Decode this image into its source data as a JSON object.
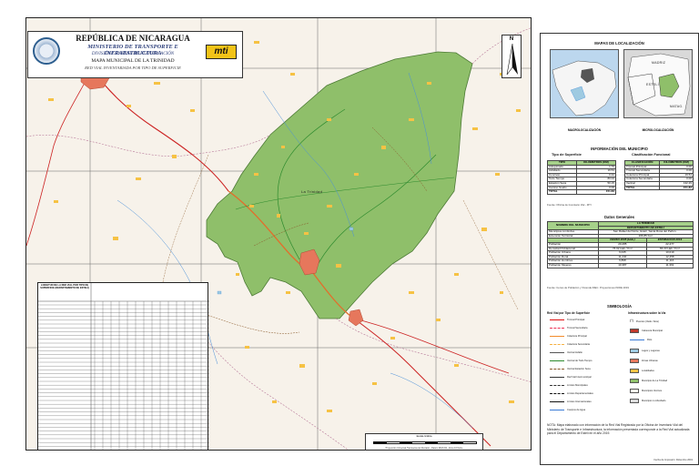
{
  "title": {
    "country": "REPÚBLICA DE NICARAGUA",
    "ministry": "MINISTERIO DE TRANSPORTE E INFRAESTRUCTURA",
    "division": "DIVISIÓN GENERAL DE PLANIFICACIÓN",
    "map_name": "MAPA MUNICIPAL DE LA TRINIDAD",
    "subtitle": "RED VIAL INVENTARIADA POR TIPO DE SUPERFICIE",
    "logo_text": "mti"
  },
  "map": {
    "north_label": "N",
    "town_label": "La Trinidad"
  },
  "scale": {
    "title": "Escala Gráfica",
    "footer": "Proyección Universal Transversa de Mercator · Datum WGS 84 · Zona 16 Norte"
  },
  "length_table": {
    "title": "LONGITUD DE LA RED VIAL POR TIPO DE SUPERFICIE (DEPARTAMENTO DE ESTELÍ)"
  },
  "panel": {
    "loc_header": "MAPAS DE LOCALIZACIÓN",
    "macro_caption": "MACROLOCALIZACIÓN",
    "micro_caption": "MICROLOCALIZACIÓN",
    "micro_labels": [
      "MADRIZ",
      "ESTELÍ",
      "MATAG."
    ],
    "info_header": "INFORMACIÓN DEL MUNICIPIO",
    "surface_title": "Tipo de Superficie",
    "functional_title": "Clasificación Funcional",
    "surface_table": {
      "headers": [
        "TIPO",
        "KILÓMETROS (KM)"
      ],
      "rows": [
        [
          "Adoquinado",
          "1.70"
        ],
        [
          "Asfaltado",
          "19.54"
        ],
        [
          "Concreto",
          "0.42"
        ],
        [
          "Todo Tiempo",
          "80.02"
        ],
        [
          "Estación Seca",
          "50.15"
        ],
        [
          "Camino Suelto",
          "0.00"
        ]
      ],
      "total": [
        "TOTAL",
        "151.83"
      ]
    },
    "functional_table": {
      "headers": [
        "CLASIFICACIÓN",
        "KILÓMETROS (KM)"
      ],
      "rows": [
        [
          "Troncal Principal",
          "0.00"
        ],
        [
          "Troncal Secundaria",
          "0.00"
        ],
        [
          "Colectora Principal",
          "19.54"
        ],
        [
          "Colectora Secundaria",
          "0.00"
        ],
        [
          "Vecinal",
          "132.29"
        ]
      ],
      "total": [
        "TOTAL",
        "151.83"
      ]
    },
    "source1": "Fuente: Oficina de Inventario Vial - MTI",
    "general_header": "Datos Generales",
    "general_table": {
      "col1": "NOMBRE DEL MUNICIPIO",
      "col2a": "LA TRINIDAD",
      "col2b": "DEPARTAMENTO DE ESTELÍ",
      "rows": [
        [
          "Municipios Limítrofes",
          "San Rafael del Norte, Estelí, Santa Rosa del Peñón..."
        ],
        [
          "Extensión Territorial",
          "266.85 Km²"
        ]
      ],
      "census_header": "CENSO 2005 (Hab.)",
      "estimate_header": "ESTIMACIÓN 2019",
      "pop_rows": [
        [
          "Población",
          "20,285",
          "22,477"
        ],
        [
          "Densidad Poblacional",
          "76.02 Hab / Km²",
          "84.23 Hab / Km²"
        ],
        [
          "Población Urbana",
          "9,045",
          "10,019"
        ],
        [
          "Población Rural",
          "11,240",
          "12,458"
        ],
        [
          "Población Hombres",
          "9,898",
          "11,116"
        ],
        [
          "Población Mujeres",
          "10,387",
          "11,361"
        ]
      ]
    },
    "source2": "Fuente: Censo de Población y Vivienda INEC. Proyecciones INIDE 2019",
    "symbology_header": "SIMBOLOGÍA",
    "left_legend_title": "Red Vial por Tipo de Superficie",
    "right_legend_title": "Infraestructura sobre la Vía",
    "left_legend": [
      {
        "label": "Troncal Principal",
        "color": "#d11",
        "style": "solid"
      },
      {
        "label": "Troncal Secundaria",
        "color": "#e35",
        "style": "dashed"
      },
      {
        "label": "Colectora Principal",
        "color": "#f28a2b",
        "style": "solid"
      },
      {
        "label": "Colectora Secundaria",
        "color": "#f5b041",
        "style": "dashed"
      },
      {
        "label": "Vecinal Asfalto",
        "color": "#555",
        "style": "solid"
      },
      {
        "label": "Vecinal de Todo Tiempo",
        "color": "#2e8b2e",
        "style": "solid"
      },
      {
        "label": "Vecinal Estación Seca",
        "color": "#8b5a2b",
        "style": "dashed"
      },
      {
        "label": "Red Vial Intermunicipal",
        "color": "#333",
        "style": "solid"
      },
      {
        "label": "Límites Municipales",
        "color": "#333",
        "style": "dashed"
      },
      {
        "label": "Límites Departamentales",
        "color": "#111",
        "style": "dashed"
      },
      {
        "label": "Límites Internacionales",
        "color": "#111",
        "style": "solid"
      },
      {
        "label": "Cuerpos de Agua",
        "color": "#3a7bd5",
        "style": "solid"
      }
    ],
    "right_legend": [
      {
        "label": "Puentes (Vado / Alca)",
        "color": "#333",
        "type": "icon"
      },
      {
        "label": "Cabecera Municipal",
        "color": "#c0392b",
        "type": "box"
      },
      {
        "label": "Ríos",
        "color": "#3a7bd5",
        "type": "line"
      },
      {
        "label": "Lagos y Lagunas",
        "color": "#9ecae1",
        "type": "box"
      },
      {
        "label": "Zonas Urbanas",
        "color": "#e6775c",
        "type": "box"
      },
      {
        "label": "Localidades",
        "color": "#f6c244",
        "type": "box"
      },
      {
        "label": "Municipio de La Trinidad",
        "color": "#8fbf6a",
        "type": "box"
      },
      {
        "label": "Municipios Vecinos",
        "color": "#f7f2ea",
        "type": "box"
      },
      {
        "label": "Municipio no Abordado",
        "color": "#dcdcdc",
        "type": "box"
      }
    ],
    "note": "NOTA: Mapa elaborado con información de la Red Vial Registrada por la Oficina de Inventario Vial del Ministerio de Transporte e Infraestructura; la información presentada corresponde a la Red Vial actualizada para el Departamento de Estelí en el año 2019.",
    "date": "Fecha de Impresión: Diciembre 2019"
  }
}
